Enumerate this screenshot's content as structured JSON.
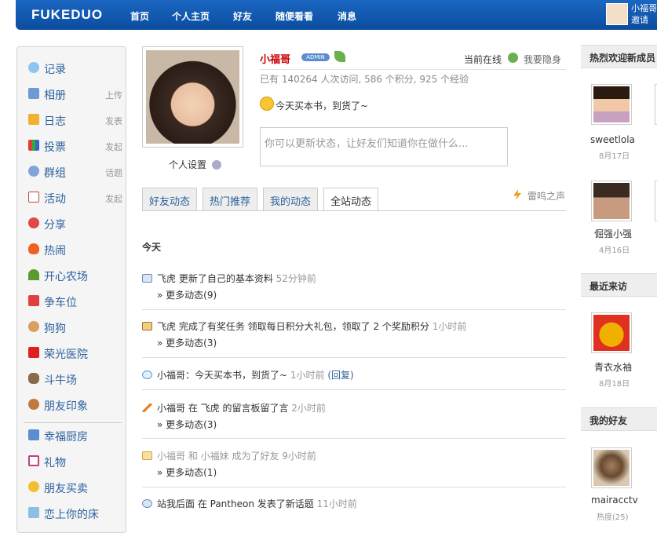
{
  "header": {
    "logo": "FUKEDUO",
    "nav": [
      "首页",
      "个人主页",
      "好友",
      "随便看看",
      "消息"
    ],
    "user_name": "小福哥",
    "invite": "邀请"
  },
  "sidebar": {
    "items": [
      {
        "label": "记录",
        "extra": ""
      },
      {
        "label": "相册",
        "extra": "上传"
      },
      {
        "label": "日志",
        "extra": "发表"
      },
      {
        "label": "投票",
        "extra": "发起"
      },
      {
        "label": "群组",
        "extra": "话题"
      },
      {
        "label": "活动",
        "extra": "发起"
      },
      {
        "label": "分享",
        "extra": ""
      },
      {
        "label": "热闹",
        "extra": ""
      },
      {
        "label": "开心农场",
        "extra": ""
      },
      {
        "label": "争车位",
        "extra": ""
      },
      {
        "label": "狗狗",
        "extra": ""
      },
      {
        "label": "荣光医院",
        "extra": ""
      },
      {
        "label": "斗牛场",
        "extra": ""
      },
      {
        "label": "朋友印象",
        "extra": ""
      },
      {
        "label": "幸福厨房",
        "extra": ""
      },
      {
        "label": "礼物",
        "extra": ""
      },
      {
        "label": "朋友买卖",
        "extra": ""
      },
      {
        "label": "恋上你的床",
        "extra": ""
      }
    ]
  },
  "profile": {
    "name": "小福哥",
    "badge": "ADMIN",
    "online": "当前在线",
    "invisible": "我要隐身",
    "stats": "已有 140264 人次访问, 586 个积分, 925 个经验",
    "status": "今天买本书，到货了~",
    "status_placeholder": "你可以更新状态，让好友们知道你在做什么...",
    "settings": "个人设置"
  },
  "tabs": [
    "好友动态",
    "热门推荐",
    "我的动态",
    "全站动态"
  ],
  "thunder": "雷鸣之声",
  "feed": {
    "day": "今天",
    "items": [
      {
        "text": "飞虎 更新了自己的基本资料",
        "time": "52分钟前",
        "more": "» 更多动态(9)"
      },
      {
        "text": "飞虎 完成了有奖任务 领取每日积分大礼包，领取了 2 个奖励积分",
        "time": "1小时前",
        "more": "» 更多动态(3)"
      },
      {
        "text": "小福哥：今天买本书，到货了~",
        "time": "1小时前",
        "reply": "(回复)"
      },
      {
        "text": "小福哥 在 飞虎 的留言板留了言",
        "time": "2小时前",
        "more": "» 更多动态(3)"
      },
      {
        "text": "小福哥 和 小福妹 成为了好友",
        "time": "9小时前",
        "more": "» 更多动态(1)"
      },
      {
        "text": "站我后面 在 Pantheon 发表了新话题",
        "time": "11小时前"
      }
    ]
  },
  "right": {
    "new_members_title": "热烈欢迎新成员",
    "new_members": [
      {
        "name": "sweetlola",
        "date": "8月17日"
      },
      {
        "name": "倔强小强",
        "date": "4月16日"
      }
    ],
    "recent_title": "最近来访",
    "recent": [
      {
        "name": "青衣水袖",
        "date": "8月18日"
      }
    ],
    "friends_title": "我的好友",
    "friends": [
      {
        "name": "mairacctv",
        "date": "热度(25)"
      }
    ]
  },
  "colors": {
    "header": "#0b4d9e",
    "link": "#2c629e",
    "name_red": "#cc0000"
  }
}
